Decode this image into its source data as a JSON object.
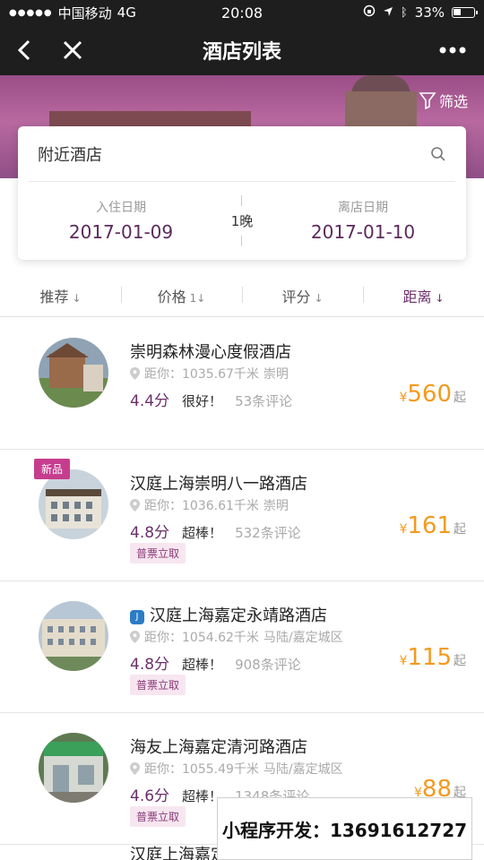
{
  "status": {
    "carrier": "中国移动",
    "network": "4G",
    "time": "20:08",
    "battery": "33%"
  },
  "nav": {
    "title": "酒店列表"
  },
  "banner": {
    "filter_label": "筛选"
  },
  "search": {
    "keyword": "附近酒店",
    "checkin_label": "入住日期",
    "checkin_date": "2017-01-09",
    "nights": "1晚",
    "checkout_label": "离店日期",
    "checkout_date": "2017-01-10"
  },
  "sort": {
    "items": [
      {
        "label": "推荐",
        "arrow": "↓",
        "active": false
      },
      {
        "label": "价格",
        "arrow": "1↓",
        "active": false
      },
      {
        "label": "评分",
        "arrow": "↓",
        "active": false
      },
      {
        "label": "距离",
        "arrow": "↓",
        "active": true
      }
    ]
  },
  "hotels": [
    {
      "name": "崇明森林漫心度假酒店",
      "distance": "距你：1035.67千米",
      "area": "崇明",
      "score": "4.4分",
      "praise": "很好！",
      "reviews": "53条评论",
      "currency": "¥",
      "price": "560",
      "price_suffix": "起"
    },
    {
      "tag": "新品",
      "name": "汉庭上海崇明八一路酒店",
      "distance": "距你：1036.61千米",
      "area": "崇明",
      "score": "4.8分",
      "praise": "超棒！",
      "reviews": "532条评论",
      "currency": "¥",
      "price": "161",
      "price_suffix": "起",
      "invoice": "普票立取"
    },
    {
      "brand_icon": "J",
      "name": "汉庭上海嘉定永靖路酒店",
      "distance": "距你：1054.62千米",
      "area": "马陆/嘉定城区",
      "score": "4.8分",
      "praise": "超棒！",
      "reviews": "908条评论",
      "currency": "¥",
      "price": "115",
      "price_suffix": "起",
      "invoice": "普票立取"
    },
    {
      "name": "海友上海嘉定清河路酒店",
      "distance": "距你：1055.49千米",
      "area": "马陆/嘉定城区",
      "score": "4.6分",
      "praise": "超棒！",
      "reviews": "1348条评论",
      "currency": "¥",
      "price": "88",
      "price_suffix": "起",
      "invoice": "普票立取"
    }
  ],
  "partial_next": "汉庭上海嘉定",
  "watermark": "小程序开发：13691612727",
  "colors": {
    "accent_purple": "#6a2f6a",
    "price_orange": "#f39a1f",
    "tag_pink": "#c63d8e"
  }
}
